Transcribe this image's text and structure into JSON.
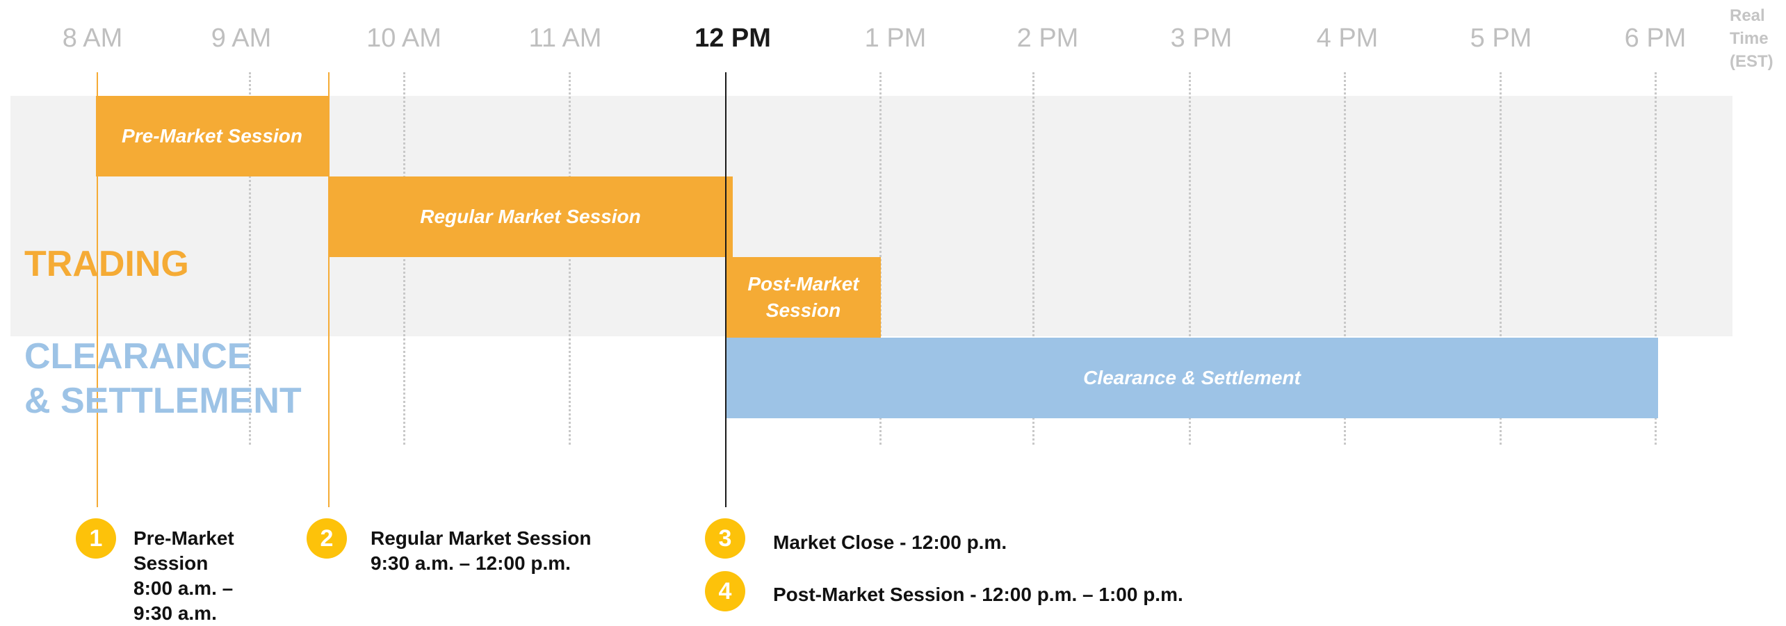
{
  "timeline": {
    "hours": [
      "8 AM",
      "9 AM",
      "10 AM",
      "11 AM",
      "12 PM",
      "1 PM",
      "2 PM",
      "3 PM",
      "4 PM",
      "5 PM",
      "6 PM"
    ],
    "current_hour": "12 PM",
    "timezone": [
      "Real",
      "Time",
      "(EST)"
    ]
  },
  "sections": {
    "trading": "TRADING",
    "clearance_line1": "CLEARANCE",
    "clearance_line2": "& SETTLEMENT"
  },
  "bars": {
    "pre_market": "Pre-Market Session",
    "regular": "Regular Market Session",
    "post_line1": "Post-Market",
    "post_line2": "Session",
    "clearance": "Clearance & Settlement"
  },
  "legend": [
    {
      "number": "1",
      "lines": [
        "Pre-Market",
        "Session",
        "8:00 a.m. –",
        "9:30 a.m."
      ]
    },
    {
      "number": "2",
      "lines": [
        "Regular Market Session",
        "9:30 a.m. – 12:00 p.m."
      ]
    },
    {
      "number": "3",
      "lines": [
        "Market Close - 12:00 p.m."
      ]
    },
    {
      "number": "4",
      "lines": [
        "Post-Market Session - 12:00 p.m. – 1:00 p.m."
      ]
    }
  ],
  "colors": {
    "trading": "#f5ab35",
    "clearance": "#9dc3e6",
    "badge": "#fdc20a",
    "band": "#f2f2f2"
  }
}
